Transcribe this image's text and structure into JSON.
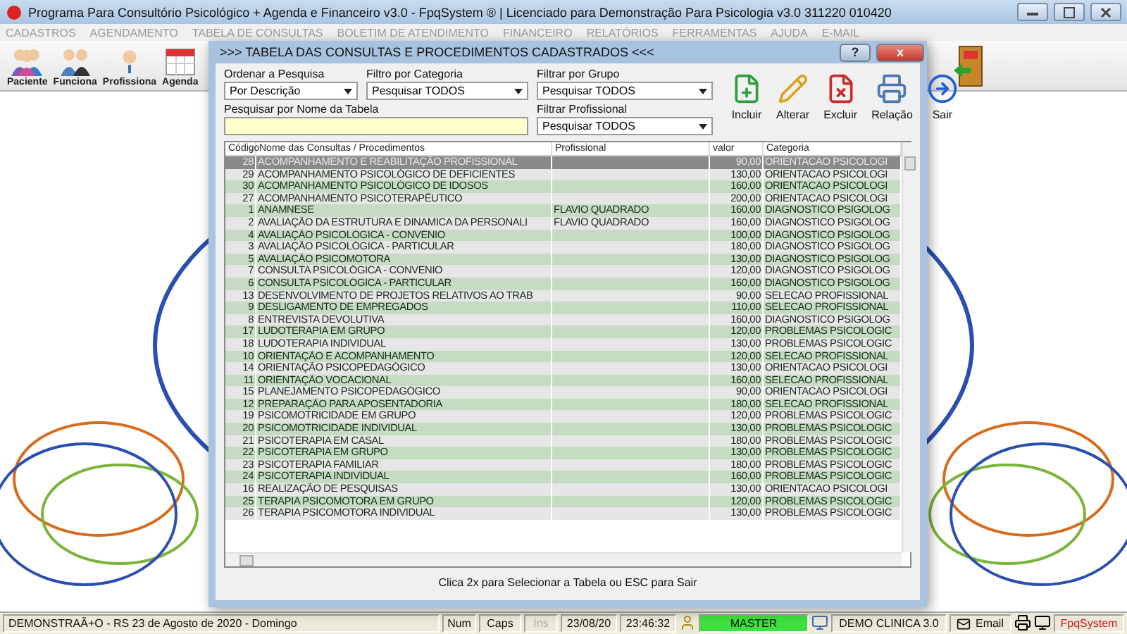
{
  "window": {
    "title": "Programa Para Consultório Psicológico + Agenda e Financeiro v3.0 - FpqSystem ® | Licenciado para  Demonstração Para Psicologia v3.0 311220 010420"
  },
  "menu": [
    "CADASTROS",
    "AGENDAMENTO",
    "TABELA DE CONSULTAS",
    "BOLETIM DE ATENDIMENTO",
    "FINANCEIRO",
    "RELATÓRIOS",
    "FERRAMENTAS",
    "AJUDA",
    "E-MAIL"
  ],
  "toolbar": [
    {
      "label": "Paciente",
      "kind": "group"
    },
    {
      "label": "Funciona",
      "kind": "couple"
    },
    {
      "label": "Profissiona",
      "kind": "doctor"
    },
    {
      "label": "Agenda",
      "kind": "calendar"
    }
  ],
  "dialog": {
    "title": ">>> TABELA DAS CONSULTAS E PROCEDIMENTOS CADASTRADOS <<<",
    "help": "?",
    "close": "x",
    "filters": [
      {
        "label": "Ordenar a Pesquisa",
        "value": "Por Descrição"
      },
      {
        "label": "Filtro por Categoria",
        "value": "Pesquisar TODOS"
      },
      {
        "label": "Filtrar por Grupo",
        "value": "Pesquisar TODOS"
      },
      {
        "label": "Filtrar Profissional",
        "value": "Pesquisar TODOS"
      }
    ],
    "search": {
      "label": "Pesquisar por Nome da Tabela"
    },
    "actions": [
      {
        "label": "Incluir",
        "kind": "add"
      },
      {
        "label": "Alterar",
        "kind": "edit"
      },
      {
        "label": "Excluir",
        "kind": "delete"
      },
      {
        "label": "Relação",
        "kind": "print"
      },
      {
        "label": "Sair",
        "kind": "exit"
      }
    ],
    "columns": [
      "Código",
      "Nome das Consultas / Procedimentos",
      "Profissional",
      "valor",
      "Categoria"
    ],
    "rows": [
      {
        "code": "28",
        "name": "ACOMPANHAMENTO E REABILITAÇÃO PROFISSIONAL",
        "value": "90,00",
        "category": "ORIENTACAO PSICOLOGI",
        "selected": true
      },
      {
        "code": "29",
        "name": "ACOMPANHAMENTO PSICOLÓGICO DE DEFICIENTES",
        "value": "130,00",
        "category": "ORIENTACAO PSICOLOGI",
        "selected": false
      },
      {
        "code": "30",
        "name": "ACOMPANHAMENTO PSICOLÓGICO DE IDOSOS",
        "value": "160,00",
        "category": "ORIENTACAO PSICOLOGI",
        "selected": false
      },
      {
        "code": "27",
        "name": "ACOMPANHAMENTO PSICOTERAPÊUTICO",
        "value": "200,00",
        "category": "ORIENTACAO PSICOLOGI",
        "selected": false
      },
      {
        "code": "1",
        "name": "ANAMNESE",
        "professional": "FLAVIO QUADRADO",
        "value": "160,00",
        "category": "DIAGNOSTICO PSIGOLOG",
        "selected": false
      },
      {
        "code": "2",
        "name": "AVALIAÇÃO DA ESTRUTURA E DINAMICA DA PERSONALI",
        "professional": "FLAVIO QUADRADO",
        "value": "160,00",
        "category": "DIAGNOSTICO PSIGOLOG",
        "selected": false
      },
      {
        "code": "4",
        "name": "AVALIAÇÃO PSICOLÓGICA - CONVENIO",
        "value": "100,00",
        "category": "DIAGNOSTICO PSIGOLOG",
        "selected": false
      },
      {
        "code": "3",
        "name": "AVALIAÇÃO PSICOLÓGICA - PARTICULAR",
        "value": "180,00",
        "category": "DIAGNOSTICO PSIGOLOG",
        "selected": false
      },
      {
        "code": "5",
        "name": "AVALIAÇÃO PSICOMOTORA",
        "value": "130,00",
        "category": "DIAGNOSTICO PSIGOLOG",
        "selected": false
      },
      {
        "code": "7",
        "name": "CONSULTA PSICOLÓGICA - CONVENIO",
        "value": "120,00",
        "category": "DIAGNOSTICO PSIGOLOG",
        "selected": false
      },
      {
        "code": "6",
        "name": "CONSULTA PSICOLÓGICA - PARTICULAR",
        "value": "160,00",
        "category": "DIAGNOSTICO PSIGOLOG",
        "selected": false
      },
      {
        "code": "13",
        "name": "DESENVOLVIMENTO DE PROJETOS RELATIVOS AO TRAB",
        "value": "90,00",
        "category": "SELECAO PROFISSIONAL",
        "selected": false
      },
      {
        "code": "9",
        "name": "DESLIGAMENTO DE EMPREGADOS",
        "value": "110,00",
        "category": "SELECAO PROFISSIONAL",
        "selected": false
      },
      {
        "code": "8",
        "name": "ENTREVISTA DEVOLUTIVA",
        "value": "160,00",
        "category": "DIAGNOSTICO PSIGOLOG",
        "selected": false
      },
      {
        "code": "17",
        "name": "LUDOTERAPIA EM GRUPO",
        "value": "120,00",
        "category": "PROBLEMAS PSICOLOGIC",
        "selected": false
      },
      {
        "code": "18",
        "name": "LUDOTERAPIA INDIVIDUAL",
        "value": "130,00",
        "category": "PROBLEMAS PSICOLOGIC",
        "selected": false
      },
      {
        "code": "10",
        "name": "ORIENTAÇÃO E ACOMPANHAMENTO",
        "value": "120,00",
        "category": "SELECAO PROFISSIONAL",
        "selected": false
      },
      {
        "code": "14",
        "name": "ORIENTAÇÃO PSICOPEDAGÓGICO",
        "value": "130,00",
        "category": "ORIENTACAO PSICOLOGI",
        "selected": false
      },
      {
        "code": "11",
        "name": "ORIENTAÇÃO VOCACIONAL",
        "value": "160,00",
        "category": "SELECAO PROFISSIONAL",
        "selected": false
      },
      {
        "code": "15",
        "name": "PLANEJAMENTO PSICOPEDAGÓGICO",
        "value": "90,00",
        "category": "ORIENTACAO PSICOLOGI",
        "selected": false
      },
      {
        "code": "12",
        "name": "PREPARAÇÃO PARA APOSENTADORIA",
        "value": "180,00",
        "category": "SELECAO PROFISSIONAL",
        "selected": false
      },
      {
        "code": "19",
        "name": "PSICOMOTRICIDADE EM GRUPO",
        "value": "120,00",
        "category": "PROBLEMAS PSICOLOGIC",
        "selected": false
      },
      {
        "code": "20",
        "name": "PSICOMOTRICIDADE INDIVIDUAL",
        "value": "130,00",
        "category": "PROBLEMAS PSICOLOGIC",
        "selected": false
      },
      {
        "code": "21",
        "name": "PSICOTERAPIA EM CASAL",
        "value": "180,00",
        "category": "PROBLEMAS PSICOLOGIC",
        "selected": false
      },
      {
        "code": "22",
        "name": "PSICOTERAPIA EM GRUPO",
        "value": "130,00",
        "category": "PROBLEMAS PSICOLOGIC",
        "selected": false
      },
      {
        "code": "23",
        "name": "PSICOTERAPIA FAMILIAR",
        "value": "180,00",
        "category": "PROBLEMAS PSICOLOGIC",
        "selected": false
      },
      {
        "code": "24",
        "name": "PSICOTERAPIA INDIVIDUAL",
        "value": "160,00",
        "category": "PROBLEMAS PSICOLOGIC",
        "selected": false
      },
      {
        "code": "16",
        "name": "REALIZAÇÃO DE PESQUISAS",
        "value": "130,00",
        "category": "ORIENTACAO PSICOLOGI",
        "selected": false
      },
      {
        "code": "25",
        "name": "TERAPIA PSICOMOTORA EM GRUPO",
        "value": "120,00",
        "category": "PROBLEMAS PSICOLOGIC",
        "selected": false
      },
      {
        "code": "26",
        "name": "TERAPIA PSICOMOTORA INDIVIDUAL",
        "value": "130,00",
        "category": "PROBLEMAS PSICOLOGIC",
        "selected": false
      }
    ],
    "hint": "Clica 2x para Selecionar a Tabela ou ESC para Sair"
  },
  "status_bar": {
    "info": "DEMONSTRAÃ+O - RS 23 de Agosto de 2020 - Domingo",
    "panels": [
      {
        "text": "Num",
        "kind": "key",
        "disabled": false
      },
      {
        "text": "Caps",
        "kind": "key",
        "disabled": false
      },
      {
        "text": "Ins",
        "kind": "key",
        "disabled": true
      },
      {
        "text": "23/08/20",
        "kind": "plain"
      },
      {
        "text": "23:46:32",
        "kind": "plain"
      },
      {
        "text": "MASTER",
        "kind": "user"
      },
      {
        "text": "DEMO CLINICA 3.0",
        "kind": "clinic"
      },
      {
        "text": "Email",
        "kind": "email"
      },
      {
        "text": "FpqSystem",
        "kind": "brand"
      }
    ]
  }
}
